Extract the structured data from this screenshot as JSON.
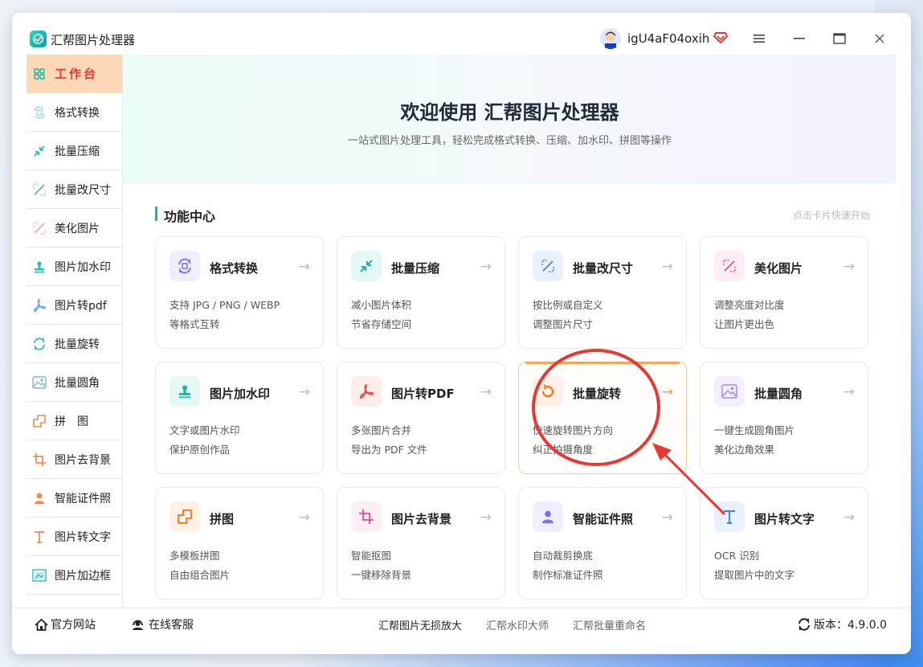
{
  "window": {
    "app_title": "汇帮图片处理器",
    "username": "igU4aF04oxih"
  },
  "sidebar": {
    "items": [
      {
        "label": "工作台",
        "icon": "grid-icon"
      },
      {
        "label": "格式转换",
        "icon": "convert-icon"
      },
      {
        "label": "批量压缩",
        "icon": "compress-icon"
      },
      {
        "label": "批量改尺寸",
        "icon": "resize-icon"
      },
      {
        "label": "美化图片",
        "icon": "beautify-icon"
      },
      {
        "label": "图片加水印",
        "icon": "stamp-icon"
      },
      {
        "label": "图片转pdf",
        "icon": "pdf-icon"
      },
      {
        "label": "批量旋转",
        "icon": "rotate-icon"
      },
      {
        "label": "批量圆角",
        "icon": "image-icon"
      },
      {
        "label": "拼　图",
        "icon": "puzzle-icon"
      },
      {
        "label": "图片去背景",
        "icon": "crop-icon"
      },
      {
        "label": "智能证件照",
        "icon": "person-icon"
      },
      {
        "label": "图片转文字",
        "icon": "text-icon"
      },
      {
        "label": "图片加边框",
        "icon": "frame-icon"
      }
    ]
  },
  "hero": {
    "title": "欢迎使用 汇帮图片处理器",
    "subtitle": "一站式图片处理工具，轻松完成格式转换、压缩、加水印、拼图等操作"
  },
  "section": {
    "title": "功能中心",
    "hint": "点击卡片快速开始"
  },
  "cards": [
    {
      "title": "格式转换",
      "l1": "支持 JPG / PNG / WEBP",
      "l2": "等格式互转",
      "color": "#7c6cf0",
      "bg": "#f0eefe"
    },
    {
      "title": "批量压缩",
      "l1": "减小图片体积",
      "l2": "节省存储空间",
      "color": "#14b8a6",
      "bg": "#e6f8f5"
    },
    {
      "title": "批量改尺寸",
      "l1": "按比例或自定义",
      "l2": "调整图片尺寸",
      "color": "#3b82f6",
      "bg": "#e8f1fd"
    },
    {
      "title": "美化图片",
      "l1": "调整亮度对比度",
      "l2": "让图片更出色",
      "color": "#ec4899",
      "bg": "#fdeef5"
    },
    {
      "title": "图片加水印",
      "l1": "文字或图片水印",
      "l2": "保护原创作品",
      "color": "#14b8a6",
      "bg": "#e6f8f5"
    },
    {
      "title": "图片转PDF",
      "l1": "多张图片合并",
      "l2": "导出为 PDF 文件",
      "color": "#ef4444",
      "bg": "#fdecec"
    },
    {
      "title": "批量旋转",
      "l1": "快速旋转图片方向",
      "l2": "纠正拍摄角度",
      "color": "#f97316",
      "bg": "#fff1e6"
    },
    {
      "title": "批量圆角",
      "l1": "一键生成圆角图片",
      "l2": "美化边角效果",
      "color": "#8b5cf6",
      "bg": "#f3effd"
    },
    {
      "title": "拼图",
      "l1": "多模板拼图",
      "l2": "自由组合图片",
      "color": "#f97316",
      "bg": "#fff1e6"
    },
    {
      "title": "图片去背景",
      "l1": "智能抠图",
      "l2": "一键移除背景",
      "color": "#ec4899",
      "bg": "#fdeef5"
    },
    {
      "title": "智能证件照",
      "l1": "自动裁剪换底",
      "l2": "制作标准证件照",
      "color": "#7c6cf0",
      "bg": "#f0eefe"
    },
    {
      "title": "图片转文字",
      "l1": "OCR 识别",
      "l2": "提取图片中的文字",
      "color": "#3b82f6",
      "bg": "#e8f1fd"
    }
  ],
  "footer": {
    "website": "官方网站",
    "support": "在线客服",
    "links": [
      "汇帮图片无损放大",
      "汇帮水印大师",
      "汇帮批量重命名"
    ],
    "version": "版本：4.9.0.0"
  },
  "colors": {
    "accent": "#14b8a6",
    "annotation": "#e53935",
    "active_bg": "#fcd9b6"
  }
}
